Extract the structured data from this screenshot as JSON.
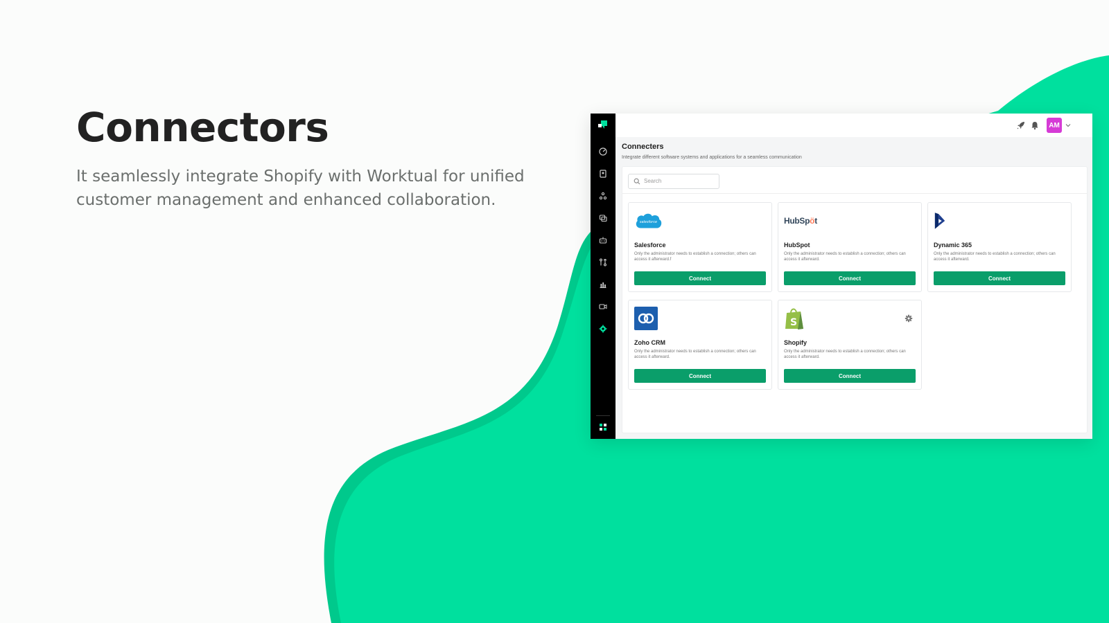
{
  "hero": {
    "title": "Connectors",
    "description": "It seamlessly integrate Shopify with Worktual for unified customer management and enhanced collaboration."
  },
  "colors": {
    "accent_green": "#00e09e",
    "button_green": "#0a9e6a",
    "sidebar_bg": "#000000",
    "avatar_bg": "#d63bd6"
  },
  "app": {
    "topbar": {
      "icons": [
        "rocket-icon",
        "bell-icon"
      ],
      "avatar_initials": "AM"
    },
    "sidebar": {
      "icons": [
        "logo-icon",
        "dashboard-icon",
        "contacts-icon",
        "team-icon",
        "chat-icon",
        "bot-icon",
        "workflow-icon",
        "reports-icon",
        "video-icon",
        "connectors-icon",
        "apps-icon"
      ]
    },
    "page": {
      "title": "Connecters",
      "subtitle": "Integrate different software systems and applications for a seamless communication"
    },
    "search": {
      "placeholder": "Search"
    },
    "cards": [
      {
        "name": "Salesforce",
        "logo_text": "salesforce",
        "description": "Only the administrator needs to establish a connection; others can access it afterward.f",
        "button": "Connect"
      },
      {
        "name": "HubSpot",
        "logo_text_a": "HubSp",
        "logo_text_b": "t",
        "description": "Only the administrator needs to establish a connection; others can access it afterward.",
        "button": "Connect"
      },
      {
        "name": "Dynamic 365",
        "description": "Only the administrator needs to establish a connection; others can access it afterward.",
        "button": "Connect"
      },
      {
        "name": "Zoho CRM",
        "description": "Only the administrator needs to establish a connection; others can access it afterward.",
        "button": "Connect"
      },
      {
        "name": "Shopify",
        "description": "Only the administrator needs to establish a connection; others can access it afterward.",
        "button": "Connect"
      }
    ]
  }
}
